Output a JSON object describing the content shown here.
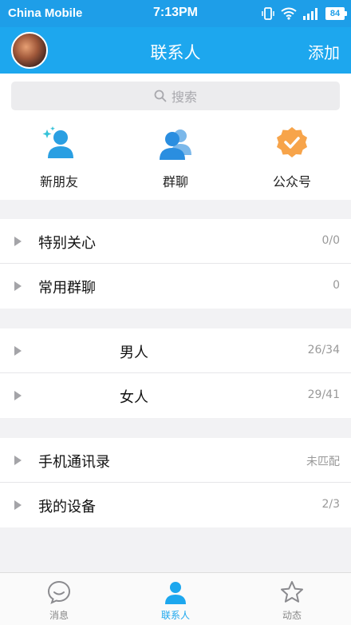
{
  "status_bar": {
    "carrier": "China Mobile",
    "time": "7:13PM",
    "battery": "84",
    "icons": [
      "vibrate-icon",
      "wifi-icon",
      "signal-icon",
      "battery-icon"
    ]
  },
  "header": {
    "title": "联系人",
    "add_label": "添加"
  },
  "search": {
    "placeholder": "搜索"
  },
  "quick_actions": [
    {
      "label": "新朋友",
      "icon": "new-friend-icon"
    },
    {
      "label": "群聊",
      "icon": "group-chat-icon"
    },
    {
      "label": "公众号",
      "icon": "official-account-icon"
    }
  ],
  "groups": {
    "section1": [
      {
        "label": "特别关心",
        "count": "0/0"
      },
      {
        "label": "常用群聊",
        "count": "0"
      }
    ],
    "section2": [
      {
        "label": "男人",
        "count": "26/34"
      },
      {
        "label": "女人",
        "count": "29/41"
      }
    ],
    "section3": [
      {
        "label": "手机通讯录",
        "count": "未匹配"
      },
      {
        "label": "我的设备",
        "count": "2/3"
      }
    ]
  },
  "tabs": [
    {
      "label": "消息",
      "icon": "message-icon",
      "active": false
    },
    {
      "label": "联系人",
      "icon": "contacts-icon",
      "active": true
    },
    {
      "label": "动态",
      "icon": "star-icon",
      "active": false
    }
  ],
  "colors": {
    "accent": "#1da7ee",
    "status_bar": "#1e9ee8",
    "orange_badge": "#f7a44a"
  }
}
